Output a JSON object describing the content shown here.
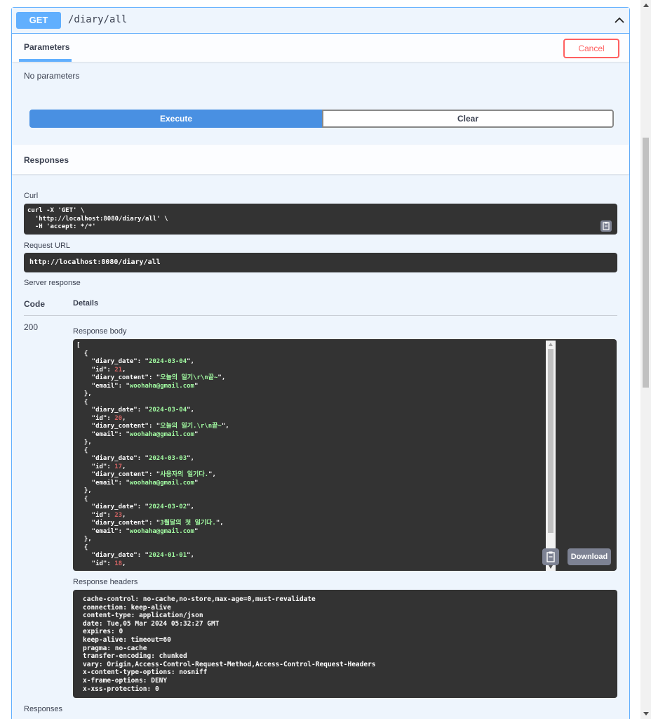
{
  "summary": {
    "method": "GET",
    "path": "/diary/all"
  },
  "parameters": {
    "tab_label": "Parameters",
    "cancel_label": "Cancel",
    "empty_text": "No parameters"
  },
  "actions": {
    "execute_label": "Execute",
    "clear_label": "Clear"
  },
  "responses": {
    "title": "Responses",
    "curl_label": "Curl",
    "curl_lines": [
      "curl -X 'GET' \\",
      "  'http://localhost:8080/diary/all' \\",
      "  -H 'accept: */*'"
    ],
    "request_url_label": "Request URL",
    "request_url": "http://localhost:8080/diary/all",
    "server_response_label": "Server response",
    "code_header": "Code",
    "details_header": "Details",
    "status_code": "200",
    "response_body_label": "Response body",
    "body_entries": [
      {
        "diary_date": "2024-03-04",
        "id": "21",
        "diary_content": "오늘의 일기\\r\\n끝~",
        "email": "woohaha@gmail.com"
      },
      {
        "diary_date": "2024-03-04",
        "id": "20",
        "diary_content": "오늘의 일기.\\r\\n끝~",
        "email": "woohaha@gmail.com"
      },
      {
        "diary_date": "2024-03-03",
        "id": "17",
        "diary_content": "사용자의 일기다.",
        "email": "woohaha@gmail.com"
      },
      {
        "diary_date": "2024-03-02",
        "id": "23",
        "diary_content": "3월달의 첫 일기다.",
        "email": "woohaha@gmail.com"
      },
      {
        "diary_date": "2024-01-01",
        "id": "18"
      }
    ],
    "download_label": "Download",
    "response_headers_label": "Response headers",
    "headers_lines": [
      "cache-control: no-cache,no-store,max-age=0,must-revalidate",
      "connection: keep-alive",
      "content-type: application/json",
      "date: Tue,05 Mar 2024 05:32:27 GMT",
      "expires: 0",
      "keep-alive: timeout=60",
      "pragma: no-cache",
      "transfer-encoding: chunked",
      "vary: Origin,Access-Control-Request-Method,Access-Control-Request-Headers",
      "x-content-type-options: nosniff",
      "x-frame-options: DENY",
      "x-xss-protection: 0"
    ],
    "bottom_title": "Responses"
  },
  "icons": {
    "collapse": "chevron-up-icon",
    "copy": "copy-icon"
  },
  "colors": {
    "get_accent": "#61affe",
    "execute": "#4990e2",
    "cancel": "#ff6060",
    "code_bg": "#333333",
    "json_string": "#a2fca2",
    "json_number": "#d36363"
  }
}
